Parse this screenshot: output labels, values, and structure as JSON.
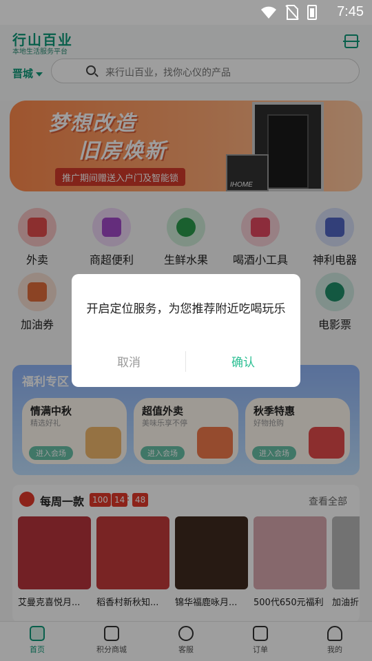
{
  "status": {
    "time": "7:45"
  },
  "header": {
    "logo": "行山百业",
    "tagline": "本地生活服务平台",
    "city": "晋城",
    "search_placeholder": "来行山百业，找你心仪的产品"
  },
  "banner": {
    "line1": "梦想改造",
    "line2": "旧房焕新",
    "sub": "推广期间赠送入户门及智能锁",
    "lock_text": "IHOME"
  },
  "categories": [
    {
      "label": "外卖",
      "color": "#f6c4c4",
      "glyph": "#e34d4d"
    },
    {
      "label": "商超便利",
      "color": "#ecd6f4",
      "glyph": "#a24ac9"
    },
    {
      "label": "生鲜水果",
      "color": "#cdebd7",
      "glyph": "#2b9b4c"
    },
    {
      "label": "喝酒小工具",
      "color": "#f6cfd6",
      "glyph": "#e2485f"
    },
    {
      "label": "神利电器",
      "color": "#d5ddf5",
      "glyph": "#5167c4"
    },
    {
      "label": "加油券",
      "color": "#f6ddd0",
      "glyph": "#e06d3a"
    },
    {
      "label": "电影票",
      "color": "#cfe9e1",
      "glyph": "#1f8f6a"
    }
  ],
  "welfare": {
    "title": "福利专区",
    "cards": [
      {
        "title": "情满中秋",
        "sub": "精选好礼",
        "btn": "进入会场",
        "pic": "#f1b86c"
      },
      {
        "title": "超值外卖",
        "sub": "美味乐享不停",
        "btn": "进入会场",
        "pic": "#f07a4b"
      },
      {
        "title": "秋季特惠",
        "sub": "好物抢购",
        "btn": "进入会场",
        "pic": "#e24b4b"
      }
    ]
  },
  "weekly": {
    "title": "每周一款",
    "timer": [
      "100",
      "14",
      "48"
    ],
    "view_all": "查看全部",
    "products": [
      {
        "name": "艾曼克喜悦月...",
        "color": "#b8343c"
      },
      {
        "name": "稻香村新秋知...",
        "color": "#c43a3a"
      },
      {
        "name": "锦华福鹿咏月...",
        "color": "#3f2b1f"
      },
      {
        "name": "500代650元福利",
        "color": "#d8a8ae"
      },
      {
        "name": "加油折",
        "color": "#b9b9b9"
      }
    ]
  },
  "tabs": [
    {
      "label": "首页",
      "active": true
    },
    {
      "label": "积分商城",
      "active": false
    },
    {
      "label": "客服",
      "active": false
    },
    {
      "label": "订单",
      "active": false
    },
    {
      "label": "我的",
      "active": false
    }
  ],
  "dialog": {
    "message": "开启定位服务，为您推荐附近吃喝玩乐",
    "cancel": "取消",
    "confirm": "确认"
  }
}
